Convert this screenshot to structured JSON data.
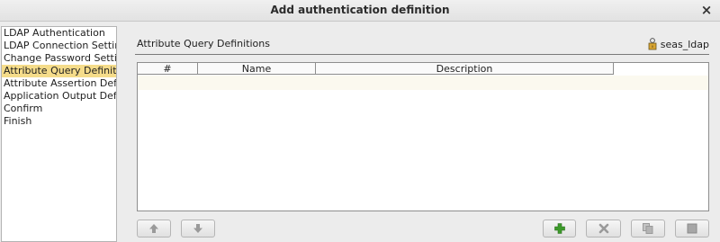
{
  "window": {
    "title": "Add authentication definition",
    "close_glyph": "×"
  },
  "steps": [
    {
      "label": "LDAP Authentication",
      "active": false
    },
    {
      "label": "LDAP Connection Settings",
      "active": false
    },
    {
      "label": "Change Password Settings",
      "active": false
    },
    {
      "label": "Attribute Query Definitions",
      "active": true
    },
    {
      "label": "Attribute Assertion Definitions",
      "active": false
    },
    {
      "label": "Application Output Definitions",
      "active": false
    },
    {
      "label": "Confirm",
      "active": false
    },
    {
      "label": "Finish",
      "active": false
    }
  ],
  "main": {
    "section_title": "Attribute Query Definitions",
    "user": "seas_ldap",
    "user_icon": "user-lock-icon",
    "table": {
      "columns": [
        "#",
        "Name",
        "Description"
      ],
      "rows": []
    }
  },
  "toolbar": {
    "up_icon": "arrow-up-icon",
    "down_icon": "arrow-down-icon",
    "add_icon": "plus-icon",
    "remove_icon": "x-icon",
    "copy_icon": "copy-icon",
    "stop_icon": "stop-icon"
  },
  "colors": {
    "selected_step": "#f5dc8a",
    "add_icon": "#3c9a2a",
    "disabled_icon": "#9a9a9a"
  }
}
